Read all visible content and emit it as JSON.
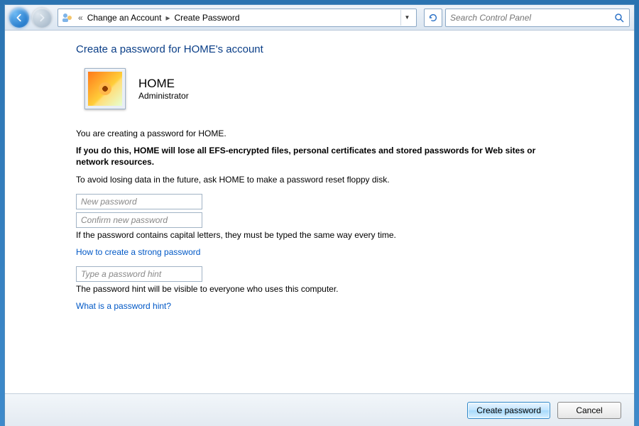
{
  "breadcrumb": {
    "seg1": "Change an Account",
    "seg2": "Create Password"
  },
  "search": {
    "placeholder": "Search Control Panel"
  },
  "page_title": "Create a password for HOME's account",
  "user": {
    "name": "HOME",
    "role": "Administrator"
  },
  "body": {
    "intro": "You are creating a password for HOME.",
    "warning": "If you do this, HOME will lose all EFS-encrypted files, personal certificates and stored passwords for Web sites or network resources.",
    "floppy": "To avoid losing data in the future, ask HOME to make a password reset floppy disk.",
    "caps_note": "If the password contains capital letters, they must be typed the same way every time.",
    "strong_link": "How to create a strong password",
    "hint_note": "The password hint will be visible to everyone who uses this computer.",
    "hint_link": "What is a password hint?"
  },
  "fields": {
    "new_pw": "New password",
    "confirm_pw": "Confirm new password",
    "hint": "Type a password hint"
  },
  "buttons": {
    "create": "Create password",
    "cancel": "Cancel"
  }
}
